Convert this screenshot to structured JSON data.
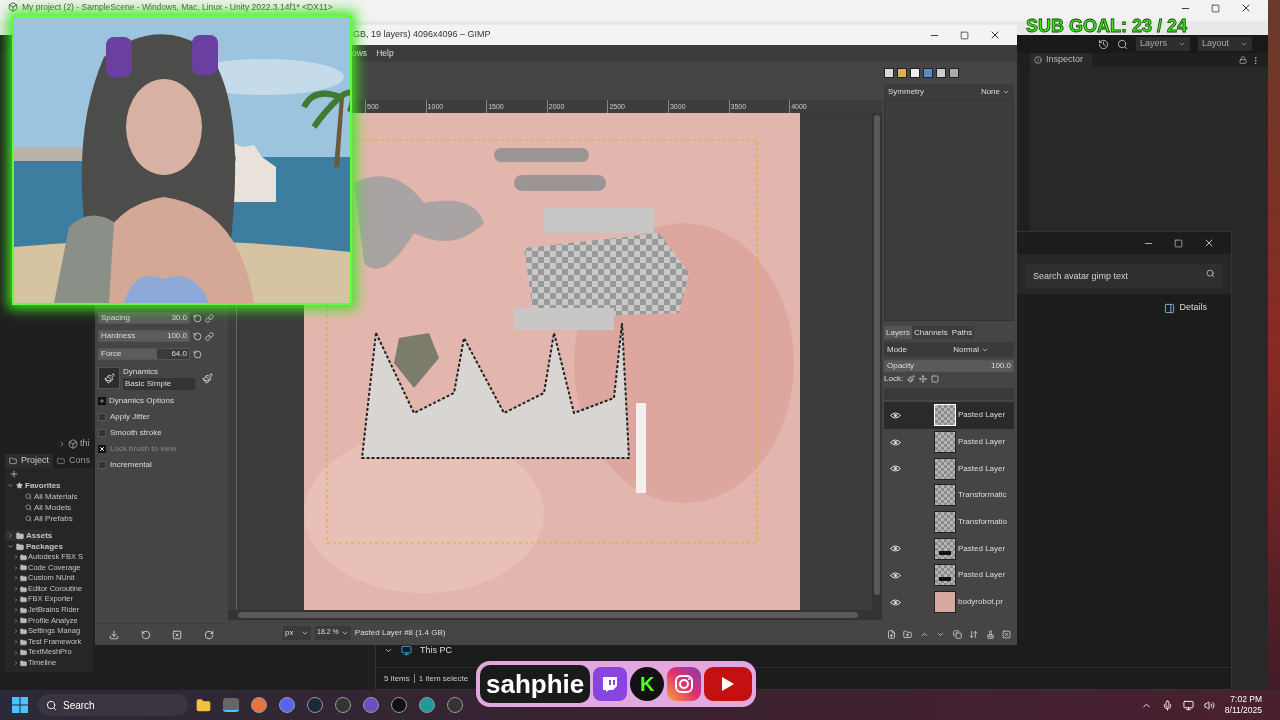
{
  "unity": {
    "title": "My project (2) - SampleScene - Windows, Mac, Linux - Unity 2022.3.14f1* <DX11>",
    "toolbar": {
      "layers": "Layers",
      "layout": "Layout"
    },
    "inspector_tab": "Inspector",
    "hierarchy_item": "thi",
    "project_tabs": [
      {
        "label": "Project",
        "selected": true
      },
      {
        "label": "Cons",
        "selected": false
      }
    ],
    "favorites": {
      "label": "Favorites",
      "expanded": true,
      "items": [
        "All Materials",
        "All Models",
        "All Prefabs"
      ]
    },
    "tree": [
      {
        "label": "Assets",
        "expanded": false
      },
      {
        "label": "Packages",
        "expanded": true,
        "children": [
          {
            "label": "Autodesk FBX S"
          },
          {
            "label": "Code Coverage"
          },
          {
            "label": "Custom NUnit"
          },
          {
            "label": "Editor Coroutine"
          },
          {
            "label": "FBX Exporter"
          },
          {
            "label": "JetBrains Rider"
          },
          {
            "label": "Profile Analyze"
          },
          {
            "label": "Settings Manag"
          },
          {
            "label": "Test Framework"
          },
          {
            "label": "TextMeshPro"
          },
          {
            "label": "Timeline"
          }
        ]
      }
    ]
  },
  "gimp": {
    "title": "GB, 19 layers) 4096x4096 – GIMP",
    "menu": [
      "ows",
      "Help"
    ],
    "ruler": [
      "500",
      "1000",
      "1500",
      "2000",
      "2500",
      "3000",
      "3500",
      "4000"
    ],
    "tool_options": {
      "sliders": [
        {
          "label": "Spacing",
          "value": "30.0",
          "level": 1,
          "linked": true
        },
        {
          "label": "Hardness",
          "value": "100.0",
          "level": 1,
          "linked": true
        },
        {
          "label": "Force",
          "value": "64.0",
          "level": 0.64,
          "linked": false
        }
      ],
      "dynamics": {
        "label": "Dynamics",
        "value": "Basic Simple"
      },
      "expander": {
        "label": "Dynamics Options",
        "expanded": false
      },
      "checkboxes": [
        {
          "label": "Apply Jitter",
          "checked": false,
          "disabled": false
        },
        {
          "label": "Smooth stroke",
          "checked": false,
          "disabled": false
        },
        {
          "label": "Lock brush to view",
          "checked": true,
          "disabled": true
        },
        {
          "label": "Incremental",
          "checked": false,
          "disabled": false
        }
      ]
    },
    "status": {
      "unit": "px",
      "zoom": "18.2 %",
      "message": "Pasted Layer #8 (1.4 GB)"
    },
    "dock": {
      "symmetry": {
        "label": "Symmetry",
        "value": "None"
      },
      "tabs": [
        {
          "label": "Layers",
          "selected": true
        },
        {
          "label": "Channels",
          "selected": false
        },
        {
          "label": "Paths",
          "selected": false
        }
      ],
      "mode": {
        "label": "Mode",
        "value": "Normal"
      },
      "opacity": {
        "label": "Opacity",
        "value": "100.0",
        "level": 1
      },
      "lock_label": "Lock:",
      "layers": [
        {
          "name": "Pasted Layer",
          "visible": true,
          "selected": true,
          "kind": "transparent"
        },
        {
          "name": "Pasted Layer",
          "visible": true,
          "selected": false,
          "kind": "transparent"
        },
        {
          "name": "Pasted Layer",
          "visible": true,
          "selected": false,
          "kind": "transparent"
        },
        {
          "name": "Transformatic",
          "visible": false,
          "selected": false,
          "kind": "transparent"
        },
        {
          "name": "Transformatio",
          "visible": false,
          "selected": false,
          "kind": "transparent"
        },
        {
          "name": "Pasted Layer",
          "visible": true,
          "selected": false,
          "kind": "shapes"
        },
        {
          "name": "Pasted Layer",
          "visible": true,
          "selected": false,
          "kind": "shapes"
        },
        {
          "name": "bodyrobot.pr",
          "visible": true,
          "selected": false
        }
      ]
    }
  },
  "explorer": {
    "search": {
      "placeholder": "Search avatar gimp text"
    },
    "details": "Details",
    "nav_item": "This PC",
    "status": [
      "5 items",
      "1 item selecte"
    ]
  },
  "overlay": {
    "sub_goal": "SUB GOAL: 23 / 24",
    "brand": "sahphie",
    "kick": "K"
  },
  "taskbar": {
    "search": "Search",
    "time": "7:02 PM",
    "date": "8/11/2025"
  }
}
